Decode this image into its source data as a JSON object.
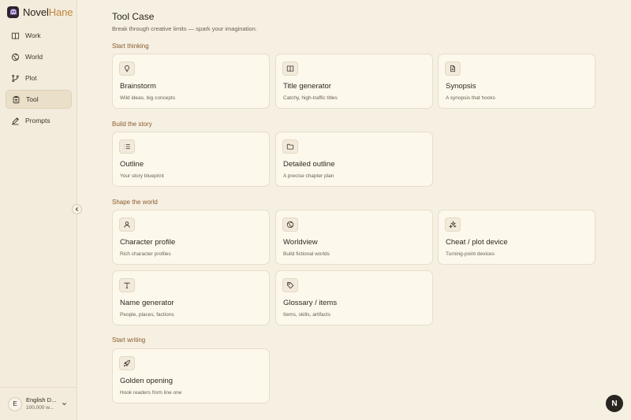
{
  "app": {
    "name_main": "Novel",
    "name_accent": "Hane"
  },
  "sidebar": {
    "items": [
      {
        "label": "Work",
        "icon": "book-icon"
      },
      {
        "label": "World",
        "icon": "globe-icon"
      },
      {
        "label": "Plot",
        "icon": "branch-icon"
      },
      {
        "label": "Tool",
        "icon": "toolbox-icon",
        "active": true
      },
      {
        "label": "Prompts",
        "icon": "pen-icon"
      }
    ],
    "account": {
      "initial": "E",
      "name": "English D...",
      "words": "100,000 w..."
    }
  },
  "page": {
    "title": "Tool Case",
    "subtitle": "Break through creative limits — spark your imagination."
  },
  "sections": [
    {
      "title": "Start thinking",
      "cards": [
        {
          "title": "Brainstorm",
          "desc": "Wild ideas, big concepts",
          "icon": "lightbulb-icon"
        },
        {
          "title": "Title generator",
          "desc": "Catchy, high-traffic titles",
          "icon": "open-book-icon"
        },
        {
          "title": "Synopsis",
          "desc": "A synopsis that hooks",
          "icon": "document-icon"
        }
      ]
    },
    {
      "title": "Build the story",
      "cards": [
        {
          "title": "Outline",
          "desc": "Your story blueprint",
          "icon": "list-icon"
        },
        {
          "title": "Detailed outline",
          "desc": "A precise chapter plan",
          "icon": "folder-icon"
        }
      ]
    },
    {
      "title": "Shape the world",
      "cards": [
        {
          "title": "Character profile",
          "desc": "Rich character profiles",
          "icon": "user-icon"
        },
        {
          "title": "Worldview",
          "desc": "Build fictional worlds",
          "icon": "globe-icon"
        },
        {
          "title": "Cheat / plot device",
          "desc": "Turning-point devices",
          "icon": "sparkles-icon"
        },
        {
          "title": "Name generator",
          "desc": "People, places, factions",
          "icon": "type-icon"
        },
        {
          "title": "Glossary / items",
          "desc": "Items, skills, artifacts",
          "icon": "tag-icon"
        }
      ]
    },
    {
      "title": "Start writing",
      "cards": [
        {
          "title": "Golden opening",
          "desc": "Hook readers from line one",
          "icon": "rocket-icon"
        }
      ]
    }
  ],
  "fab": {
    "label": "N"
  }
}
